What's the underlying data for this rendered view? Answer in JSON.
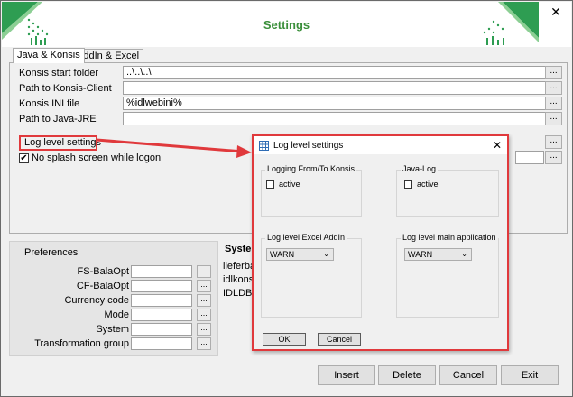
{
  "window": {
    "title": "Settings",
    "close_glyph": "✕"
  },
  "tabs": [
    {
      "label": "Java & Konsis",
      "active": true
    },
    {
      "label": "AddIn & Excel",
      "active": false
    }
  ],
  "fields": [
    {
      "label": "Konsis start folder",
      "value": "..\\..\\..\\"
    },
    {
      "label": "Path to Konsis-Client",
      "value": ""
    },
    {
      "label": "Konsis INI file",
      "value": "%idlwebini%"
    },
    {
      "label": "Path to Java-JRE",
      "value": ""
    }
  ],
  "browse_label": "...",
  "log_level_label": "Log level settings",
  "no_splash": {
    "label": "No splash screen while logon",
    "checked": true
  },
  "preferences": {
    "title": "Preferences",
    "items": [
      "FS-BalaOpt",
      "CF-BalaOpt",
      "Currency code",
      "Mode",
      "System",
      "Transformation group"
    ]
  },
  "system_panel": {
    "title": "System",
    "items": [
      "lieferba",
      "idlkonsi",
      "IDLDB"
    ]
  },
  "buttons": {
    "insert": "Insert",
    "delete": "Delete",
    "cancel": "Cancel",
    "exit": "Exit"
  },
  "dialog": {
    "title": "Log level settings",
    "close_glyph": "✕",
    "groups": {
      "logging": {
        "title": "Logging From/To Konsis",
        "checkbox": "active"
      },
      "java": {
        "title": "Java-Log",
        "checkbox": "active"
      },
      "excel": {
        "title": "Log level Excel AddIn",
        "value": "WARN"
      },
      "main": {
        "title": "Log level main application",
        "value": "WARN"
      }
    },
    "ok": "OK",
    "cancel": "Cancel"
  },
  "colors": {
    "accent_red": "#e0393c",
    "title_green": "#3a8f3a",
    "banner_green": "#4caf50"
  },
  "icons": {
    "close": "close-icon",
    "dialog": "grid-icon",
    "dropdown": "chevron-down-icon",
    "check": "checkmark-icon"
  }
}
